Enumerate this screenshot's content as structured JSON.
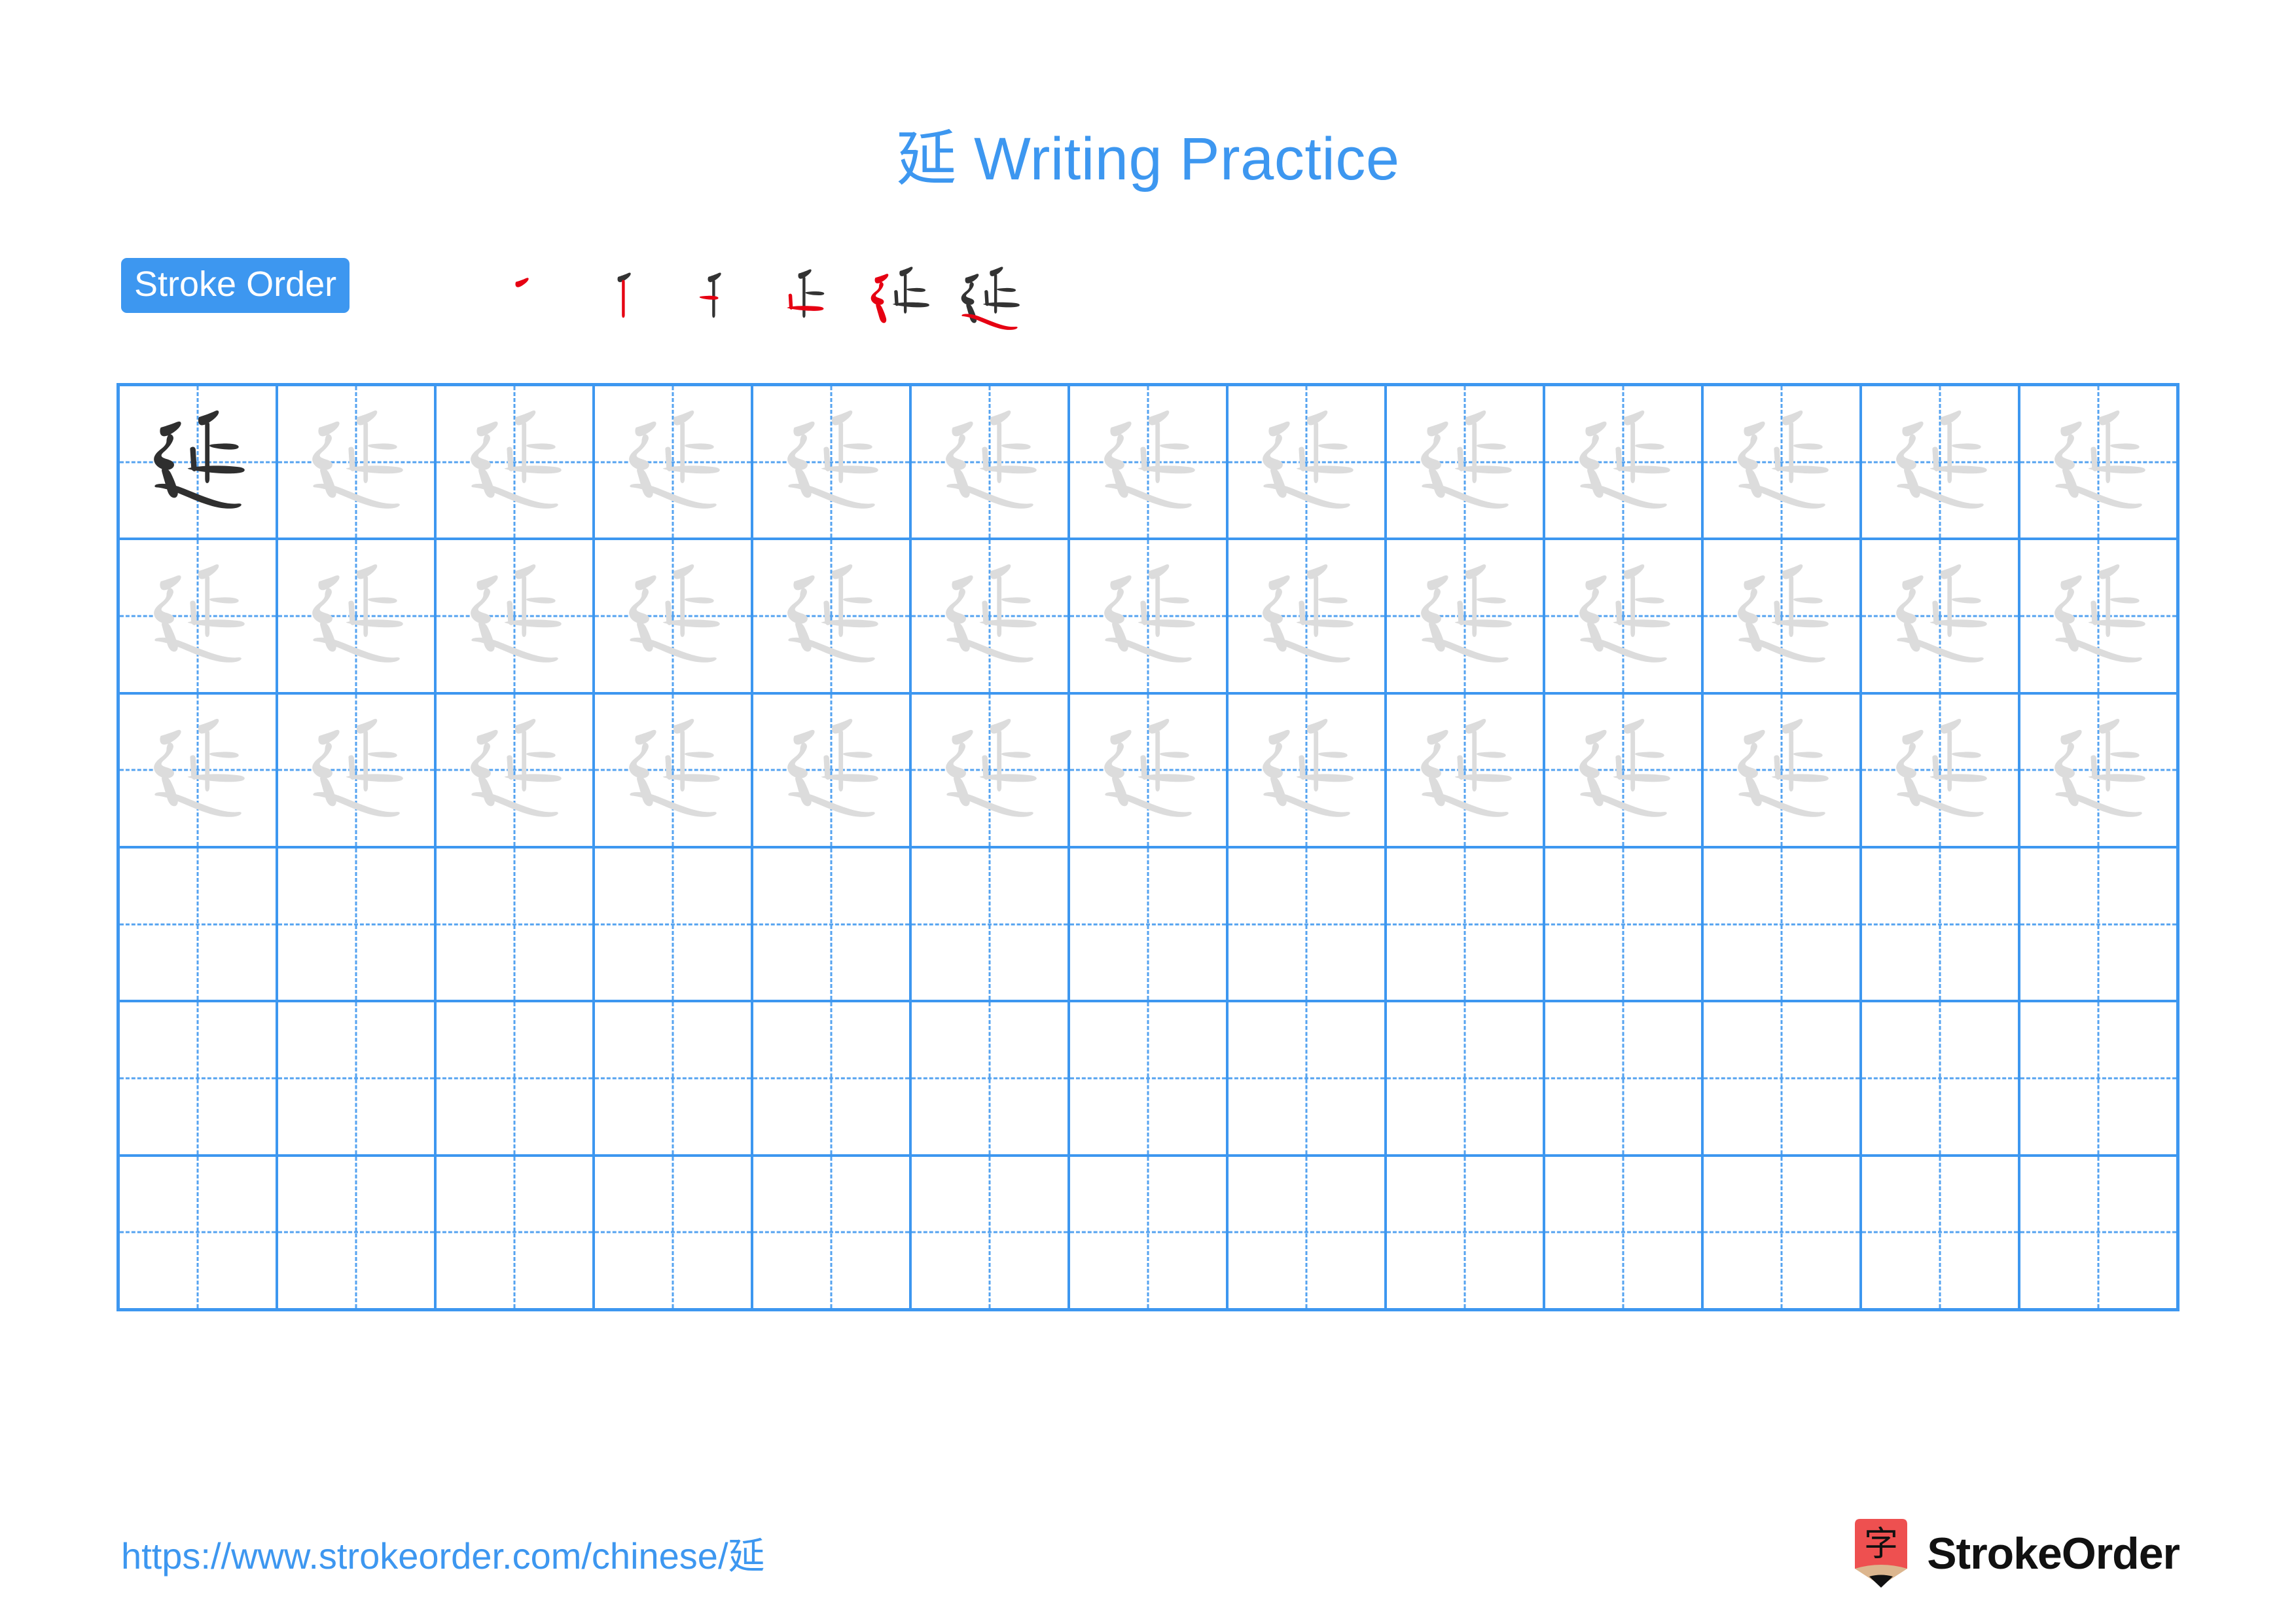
{
  "page": {
    "character": "延",
    "title": "延 Writing Practice",
    "title_char": "延",
    "title_suffix": " Writing Practice",
    "background_color": "#ffffff",
    "accent_color": "#3d97f0",
    "stroke_new_color": "#e60012",
    "stroke_done_color": "#333333",
    "trace_color": "#dcdcdc",
    "ink_color": "#2f2f2f"
  },
  "stroke_order": {
    "badge_label": "Stroke Order",
    "total_strokes": 6,
    "steps": [
      {
        "index": 1,
        "new_stroke": "㇒ (piě)",
        "strokes_drawn": 1
      },
      {
        "index": 2,
        "new_stroke": "丨 (shù)",
        "strokes_drawn": 2
      },
      {
        "index": 3,
        "new_stroke": "㇀ (tí)",
        "strokes_drawn": 3
      },
      {
        "index": 4,
        "new_stroke": "一 (héng)",
        "strokes_drawn": 4
      },
      {
        "index": 5,
        "new_stroke": "㇋ (héngzhé)",
        "strokes_drawn": 5
      },
      {
        "index": 6,
        "new_stroke": "㇏ (nà)",
        "strokes_drawn": 6
      }
    ]
  },
  "practice_grid": {
    "columns": 13,
    "rows": 6,
    "cell_guides": "dashed-cross",
    "rows_data": [
      {
        "row": 1,
        "cells": [
          "ink",
          "trace",
          "trace",
          "trace",
          "trace",
          "trace",
          "trace",
          "trace",
          "trace",
          "trace",
          "trace",
          "trace",
          "trace"
        ]
      },
      {
        "row": 2,
        "cells": [
          "trace",
          "trace",
          "trace",
          "trace",
          "trace",
          "trace",
          "trace",
          "trace",
          "trace",
          "trace",
          "trace",
          "trace",
          "trace"
        ]
      },
      {
        "row": 3,
        "cells": [
          "trace",
          "trace",
          "trace",
          "trace",
          "trace",
          "trace",
          "trace",
          "trace",
          "trace",
          "trace",
          "trace",
          "trace",
          "trace"
        ]
      },
      {
        "row": 4,
        "cells": [
          "empty",
          "empty",
          "empty",
          "empty",
          "empty",
          "empty",
          "empty",
          "empty",
          "empty",
          "empty",
          "empty",
          "empty",
          "empty"
        ]
      },
      {
        "row": 5,
        "cells": [
          "empty",
          "empty",
          "empty",
          "empty",
          "empty",
          "empty",
          "empty",
          "empty",
          "empty",
          "empty",
          "empty",
          "empty",
          "empty"
        ]
      },
      {
        "row": 6,
        "cells": [
          "empty",
          "empty",
          "empty",
          "empty",
          "empty",
          "empty",
          "empty",
          "empty",
          "empty",
          "empty",
          "empty",
          "empty",
          "empty"
        ]
      }
    ]
  },
  "footer": {
    "url": "https://www.strokeorder.com/chinese/延",
    "brand_name": "StrokeOrder",
    "logo_char": "字",
    "logo_body_color": "#ee5050",
    "logo_wood_color": "#dcb68e",
    "logo_tip_color": "#111111"
  }
}
